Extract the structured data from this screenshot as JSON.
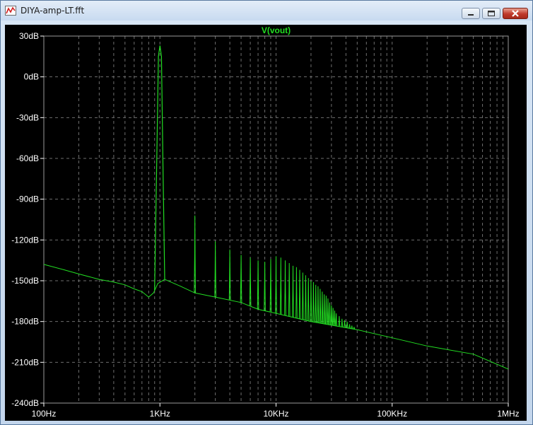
{
  "window": {
    "title": "DIYA-amp-LT.fft",
    "icons": [
      "waveform-app-icon",
      "minimize-icon",
      "maximize-icon",
      "close-icon"
    ]
  },
  "colors": {
    "background": "#000000",
    "grid": "#6e6e6e",
    "trace": "#22dd22",
    "axis_text": "#ffffff"
  },
  "chart_data": {
    "type": "line",
    "title": "V(vout)",
    "xscale": "log",
    "xlim": [
      100,
      1000000
    ],
    "ylim": [
      -240,
      30
    ],
    "grid": true,
    "xticks": [
      {
        "v": 100,
        "label": "100Hz"
      },
      {
        "v": 1000,
        "label": "1KHz"
      },
      {
        "v": 10000,
        "label": "10KHz"
      },
      {
        "v": 100000,
        "label": "100KHz"
      },
      {
        "v": 1000000,
        "label": "1MHz"
      }
    ],
    "yticks": [
      {
        "v": 30,
        "label": "30dB"
      },
      {
        "v": 0,
        "label": "0dB"
      },
      {
        "v": -30,
        "label": "-30dB"
      },
      {
        "v": -60,
        "label": "-60dB"
      },
      {
        "v": -90,
        "label": "-90dB"
      },
      {
        "v": -120,
        "label": "-120dB"
      },
      {
        "v": -150,
        "label": "-150dB"
      },
      {
        "v": -180,
        "label": "-180dB"
      },
      {
        "v": -210,
        "label": "-210dB"
      },
      {
        "v": -240,
        "label": "-240dB"
      }
    ],
    "series": [
      {
        "name": "V(vout)",
        "noise_floor": [
          [
            100,
            -138
          ],
          [
            150,
            -142
          ],
          [
            200,
            -145
          ],
          [
            300,
            -149
          ],
          [
            400,
            -151
          ],
          [
            500,
            -153
          ],
          [
            600,
            -156
          ],
          [
            700,
            -158
          ],
          [
            800,
            -162
          ],
          [
            880,
            -159
          ],
          [
            960,
            -152
          ],
          [
            1100,
            -149
          ],
          [
            1500,
            -154
          ],
          [
            2000,
            -159
          ],
          [
            3000,
            -162
          ],
          [
            5000,
            -166
          ],
          [
            7000,
            -171
          ],
          [
            10000,
            -174
          ],
          [
            20000,
            -180
          ],
          [
            50000,
            -186
          ],
          [
            100000,
            -192
          ],
          [
            200000,
            -198
          ],
          [
            500000,
            -204
          ],
          [
            1000000,
            -215
          ]
        ],
        "fundamental": {
          "x": 1000,
          "y": 23
        },
        "harmonics": [
          {
            "n": 2,
            "y": -102
          },
          {
            "n": 3,
            "y": -121
          },
          {
            "n": 4,
            "y": -127
          },
          {
            "n": 5,
            "y": -131
          },
          {
            "n": 6,
            "y": -133
          },
          {
            "n": 7,
            "y": -135
          },
          {
            "n": 8,
            "y": -136
          },
          {
            "n": 9,
            "y": -134
          },
          {
            "n": 10,
            "y": -132
          },
          {
            "n": 11,
            "y": -133
          },
          {
            "n": 12,
            "y": -135
          },
          {
            "n": 13,
            "y": -137
          },
          {
            "n": 14,
            "y": -139
          },
          {
            "n": 15,
            "y": -140
          },
          {
            "n": 16,
            "y": -142
          },
          {
            "n": 17,
            "y": -144
          },
          {
            "n": 18,
            "y": -146
          },
          {
            "n": 19,
            "y": -148
          },
          {
            "n": 20,
            "y": -150
          },
          {
            "n": 21,
            "y": -151
          },
          {
            "n": 22,
            "y": -153
          },
          {
            "n": 23,
            "y": -154
          },
          {
            "n": 24,
            "y": -156
          },
          {
            "n": 25,
            "y": -158
          },
          {
            "n": 26,
            "y": -160
          },
          {
            "n": 27,
            "y": -161
          },
          {
            "n": 28,
            "y": -163
          },
          {
            "n": 29,
            "y": -166
          },
          {
            "n": 30,
            "y": -168
          },
          {
            "n": 31,
            "y": -170
          },
          {
            "n": 32,
            "y": -172
          },
          {
            "n": 33,
            "y": -174
          },
          {
            "n": 35,
            "y": -176
          },
          {
            "n": 37,
            "y": -178
          },
          {
            "n": 39,
            "y": -179
          },
          {
            "n": 41,
            "y": -180
          },
          {
            "n": 43,
            "y": -182
          },
          {
            "n": 45,
            "y": -183
          },
          {
            "n": 47,
            "y": -184
          }
        ]
      }
    ]
  }
}
